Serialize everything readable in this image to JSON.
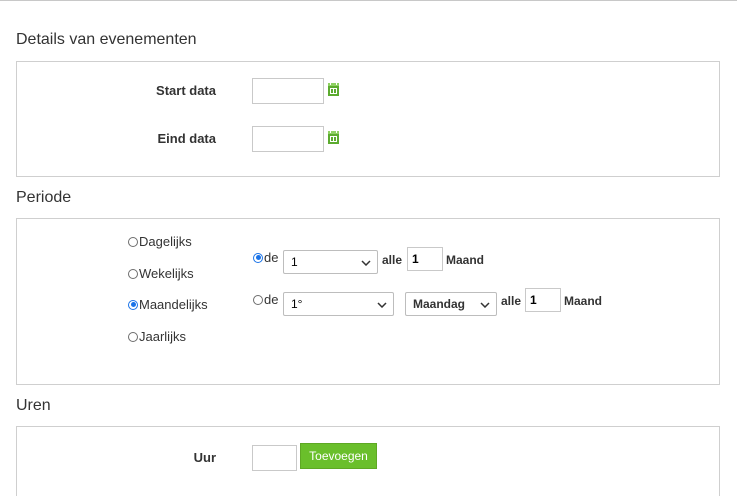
{
  "sections": {
    "details_title": "Details van evenementen",
    "periode_title": "Periode",
    "uren_title": "Uren"
  },
  "details": {
    "start_label": "Start data",
    "start_value": "",
    "end_label": "Eind data",
    "end_value": ""
  },
  "periode": {
    "options": [
      "Dagelijks",
      "Wekelijks",
      "Maandelijks",
      "Jaarlijks"
    ],
    "selected": "Maandelijks",
    "row1": {
      "prefix": "de",
      "day_select": "1",
      "every_label": "alle",
      "every_value": "1",
      "unit_label": "Maand"
    },
    "row2": {
      "prefix": "de",
      "ordinal_select": "1°",
      "weekday_select": "Maandag",
      "every_label": "alle",
      "every_value": "1",
      "unit_label": "Maand"
    }
  },
  "uren": {
    "hour_label": "Uur",
    "hour_value": "",
    "add_button": "Toevoegen"
  },
  "colors": {
    "accent_green": "#6abf2b",
    "radio_blue": "#1a73e8",
    "calendar_green": "#5cab2f"
  },
  "icons": {
    "calendar": "calendar-icon",
    "chevron": "chevron-down-icon"
  }
}
